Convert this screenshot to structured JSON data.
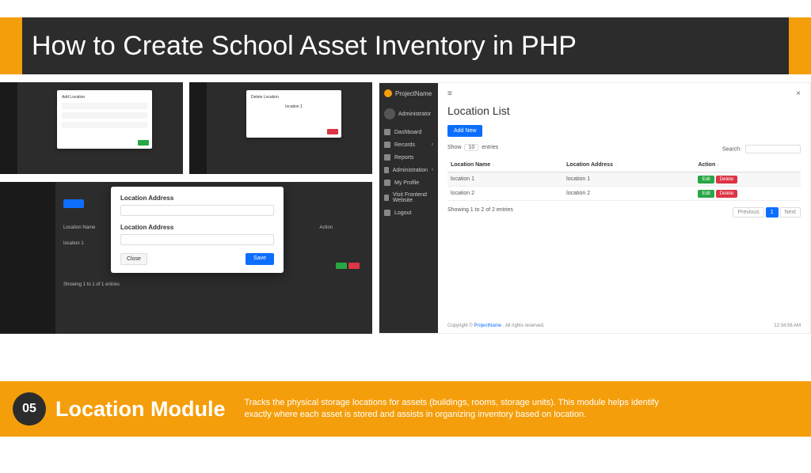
{
  "header": {
    "title": "How to Create School Asset Inventory in PHP"
  },
  "bottom": {
    "badge": "05",
    "title": "Location Module",
    "desc": "Tracks the physical storage locations for assets (buildings, rooms, storage units). This module helps identify exactly where each asset is stored and assists in organizing inventory based on location."
  },
  "big_modal": {
    "label1": "Location Address",
    "label2": "Location Address",
    "close": "Close",
    "save": "Save"
  },
  "rs": {
    "brand": "ProjectName",
    "user": "Administrator",
    "nav": [
      "Dashboard",
      "Records",
      "Reports",
      "Administration",
      "My Profile",
      "Visit Frontend Website",
      "Logout"
    ],
    "page_title": "Location List",
    "add_new": "Add New",
    "show_entries_pre": "Show",
    "show_entries_val": "10",
    "show_entries_post": "entries",
    "search_label": "Search:",
    "cols": [
      "Location Name",
      "Location Address",
      "Action"
    ],
    "rows": [
      {
        "name": "location 1",
        "addr": "location 1"
      },
      {
        "name": "location 2",
        "addr": "location 2"
      }
    ],
    "edit": "Edit",
    "delete": "Delete",
    "showing": "Showing 1 to 2 of 2 entries",
    "prev": "Previous",
    "page1": "1",
    "next": "Next",
    "copyright_pre": "Copyright ©",
    "copyright_brand": "ProjectName",
    "copyright_post": ". All rights reserved.",
    "timestamp": "12:34:56 AM"
  }
}
